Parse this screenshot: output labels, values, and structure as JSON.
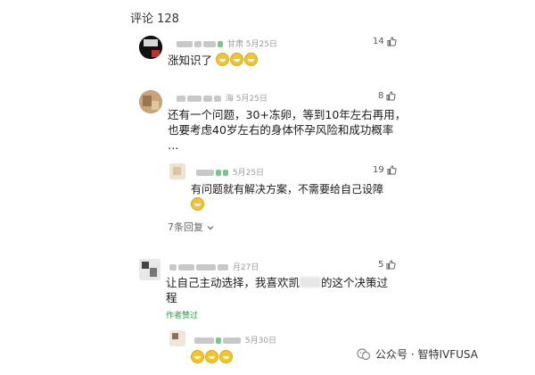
{
  "header": {
    "title": "评论 128"
  },
  "comments": [
    {
      "location_date": "甘肃 5月25日",
      "likes": "14",
      "text": "涨知识了"
    },
    {
      "location_date": "海 5月25日",
      "likes": "8",
      "text_line1": "还有一个问题，30+冻卵，等到10年左右再用，",
      "text_line2": "也要考虑40岁左右的身体怀孕风险和成功概率",
      "text_line3": "…",
      "reply": {
        "location_date": "5月25日",
        "likes": "19",
        "text_line1": "有问题就有解决方案，不需要给自己设障"
      },
      "more_replies": "7条回复"
    },
    {
      "location_date": "月27日",
      "likes": "5",
      "text_line1": "让自己主动选择，我喜欢凯",
      "text_line1_end": "的这个决策过",
      "text_line2": "程",
      "author_liked": "作者赞过",
      "reply": {
        "location_date": "5月30日"
      }
    }
  ],
  "watermark": {
    "text": "公众号 · 智特IVFUSA"
  },
  "colors": {
    "accent_green": "#2a9d4a",
    "meta_gray": "#9a9a9a",
    "emoji_yellow": "#f4c42b"
  }
}
